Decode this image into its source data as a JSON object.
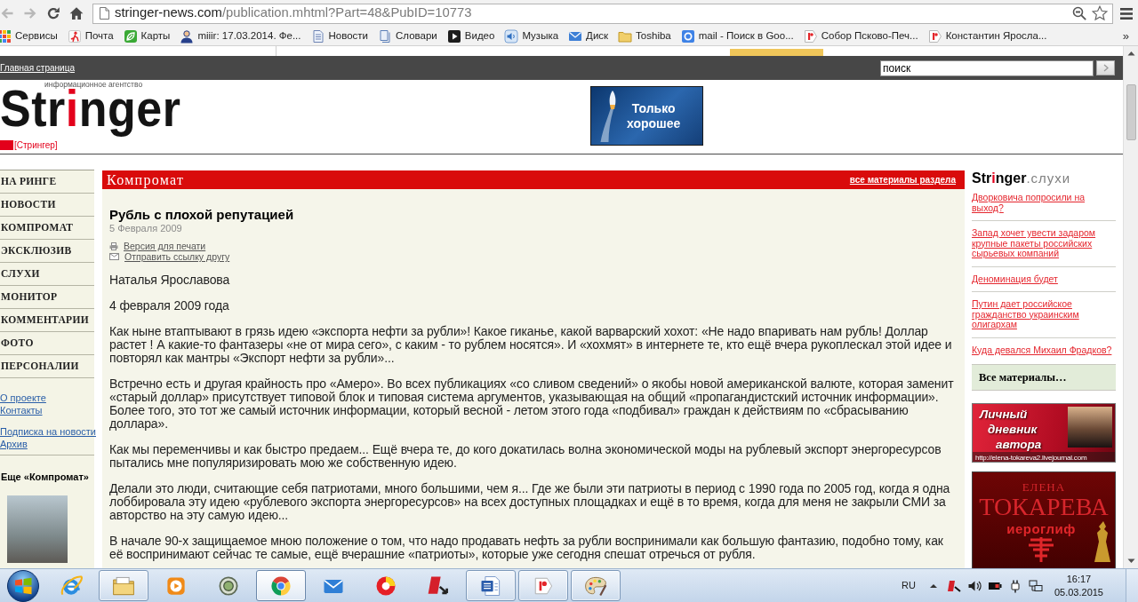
{
  "browser": {
    "nav_buttons": [
      {
        "kind": "back",
        "disabled": true
      },
      {
        "kind": "forward",
        "disabled": true
      },
      {
        "kind": "reload",
        "disabled": false
      },
      {
        "kind": "home",
        "disabled": false
      }
    ],
    "address": {
      "host": "stringer-news.com",
      "path": "/publication.mhtml?Part=48&PubID=10773"
    },
    "bookmarks": [
      "Сервисы",
      "Почта",
      "Карты",
      "miiir: 17.03.2014. Фе...",
      "Новости",
      "Словари",
      "Видео",
      "Музыка",
      "Диск",
      "Toshiba",
      "mail - Поиск в Goo...",
      "Собор Псково-Печ...",
      "Константин Яросла..."
    ],
    "bookmarks_more": "»"
  },
  "site": {
    "home_link": "Главная страница",
    "search": {
      "value": "поиск"
    },
    "logo": {
      "wordmark": "Stringer",
      "tagline": "информационное агентство",
      "subtitle": "[Стрингер]"
    },
    "ad": {
      "lines": [
        "Только",
        "хорошее"
      ]
    }
  },
  "nav": {
    "items": [
      {
        "label": "НА РИНГЕ",
        "selected": false
      },
      {
        "label": "НОВОСТИ",
        "selected": false
      },
      {
        "label": "КОМПРОМАТ",
        "selected": false
      },
      {
        "label": "ЭКСКЛЮЗИВ",
        "selected": false
      },
      {
        "label": "СЛУХИ",
        "selected": false
      },
      {
        "label": "МОНИТОР",
        "selected": false
      },
      {
        "label": "КОММЕНТАРИИ",
        "selected": false
      },
      {
        "label": "ФОТО",
        "selected": false
      },
      {
        "label": "ПЕРСОНАЛИИ",
        "selected": false
      }
    ],
    "link_groups": [
      [
        "О проекте",
        "Контакты"
      ],
      [
        "Подписка на новости",
        "Архив"
      ]
    ],
    "more_heading": "Еще «Компромат»"
  },
  "article": {
    "section": "Компромат",
    "section_link": "все материалы раздела",
    "title": "Рубль с плохой репутацией",
    "date": "5 Февраля 2009",
    "actions": [
      {
        "kind": "print",
        "label": "Версия для печати"
      },
      {
        "kind": "email",
        "label": "Отправить ссылку другу"
      }
    ],
    "author": "Наталья Ярославова",
    "dateline": "4 февраля 2009 года",
    "paragraphs": [
      "Как ныне втаптывают в грязь идею «экспорта нефти за рубли»! Какое гиканье, какой варварский хохот: «Не надо впаривать нам рубль! Доллар растет ! А какие-то фантазеры «не от мира сего», с каким - то рублем носятся». И «хохмят» в интернете те, кто ещё вчера рукоплескал этой идее и повторял как мантры «Экспорт нефти за рубли»...",
      "Встречно есть и другая крайность про «Амеро». Во всех публикациях «со сливом сведений» о якобы новой американской валюте, которая заменит «старый доллар» присутствует типовой блок и типовая система аргументов, указывающая на общий «пропагандистский источник информации». Более того, это тот же самый источник информации, который весной - летом этого года «подбивал» граждан к действиям по «сбрасыванию доллара».",
      "Как мы переменчивы и как быстро предаем... Ещё вчера те, до кого докатилась волна экономической моды на рублевый экспорт энергоресурсов пытались мне популяризировать мою же собственную идею.",
      "Делали это люди, считающие себя патриотами, много большими, чем я... Где же были эти патриоты в период с 1990 года по 2005 год, когда я одна лоббировала эту идею «рублевого экспорта энергоресурсов» на всех доступных площадках и ещё в то время, когда для меня не закрыли СМИ за авторство на эту самую идею...",
      "В начале 90-х защищаемое мною положение о том, что надо продавать нефть за рубли воспринимали как большую фантазию, подобно тому, как её воспринимают сейчас те самые, ещё вчерашние «патриоты», которые уже сегодня спешат отречься от рубля."
    ]
  },
  "sidebar": {
    "brand": "Stringer",
    "section": ".слухи",
    "links": [
      "Дворковича попросили на выход?",
      "Запад хочет увести задаром крупные пакеты российских сырьевых компаний",
      "Деноминация будет",
      "Путин дает российское гражданство украинским олигархам",
      "Куда девался Михаил Фрадков?"
    ],
    "more": "Все материалы…",
    "diary_banner": {
      "lines": [
        "Личный",
        "дневник",
        "автора"
      ],
      "url": "http://elena-tokareva2.livejournal.com"
    },
    "book_banner": {
      "first_name": "ЕЛЕНА",
      "last_name": "ТОКАРЕВА",
      "title": "иероглиф"
    }
  },
  "taskbar": {
    "apps": [
      {
        "running": false,
        "active": false
      },
      {
        "running": true,
        "active": false
      },
      {
        "running": false,
        "active": false
      },
      {
        "running": false,
        "active": false
      },
      {
        "running": true,
        "active": true
      },
      {
        "running": false,
        "active": false
      },
      {
        "running": false,
        "active": false
      },
      {
        "running": false,
        "active": false
      },
      {
        "running": true,
        "active": false
      },
      {
        "running": true,
        "active": false
      },
      {
        "running": true,
        "active": false
      }
    ],
    "language": "RU",
    "time": "16:17",
    "date": "05.03.2015"
  }
}
